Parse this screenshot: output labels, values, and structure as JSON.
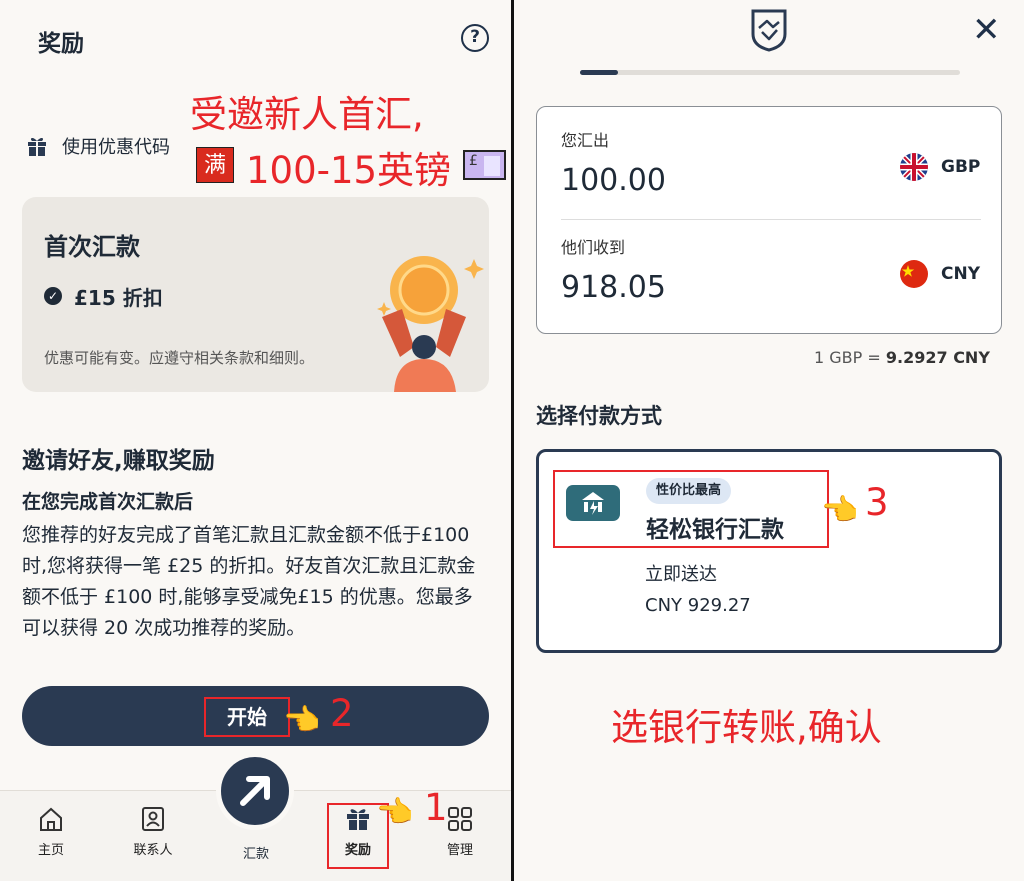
{
  "left": {
    "title": "奖励",
    "help": "?",
    "annotation_line1": "受邀新人首汇,",
    "promo_label": "使用优惠代码",
    "man_badge": "满",
    "annotation_line2": "100-15英镑",
    "banknote": "£",
    "card": {
      "title": "首次汇款",
      "discount": "£15 折扣",
      "note": "优惠可能有变。应遵守相关条款和细则。"
    },
    "invite": {
      "title": "邀请好友,赚取奖励",
      "subtitle": "在您完成首次汇款后",
      "body": "您推荐的好友完成了首笔汇款且汇款金额不低于£100 时,您将获得一笔 £25 的折扣。好友首次汇款且汇款金额不低于 £100 时,能够享受减免£15 的优惠。您最多可以获得 20 次成功推荐的奖励。"
    },
    "start_button": "开始",
    "step_2": "2",
    "step_1": "1",
    "tabs": [
      "主页",
      "联系人",
      "汇款",
      "奖励",
      "管理"
    ]
  },
  "right": {
    "you_send_label": "您汇出",
    "you_send_value": "100.00",
    "send_currency": "GBP",
    "they_receive_label": "他们收到",
    "they_receive_value": "918.05",
    "receive_currency": "CNY",
    "rate_prefix": "1 GBP = ",
    "rate_value": "9.2927 CNY",
    "section_title": "选择付款方式",
    "payment": {
      "tag": "性价比最高",
      "name": "轻松银行汇款",
      "speed": "立即送达",
      "amount": "CNY 929.27"
    },
    "step_3": "3",
    "annotation": "选银行转账,确认"
  },
  "colors": {
    "navy": "#2a3a52",
    "annotation_red": "#e8262a",
    "card_bg": "#ebe8e3"
  },
  "icons": [
    "help-icon",
    "gift-icon",
    "check-icon",
    "home-icon",
    "contacts-icon",
    "send-arrow-icon",
    "gift-tab-icon",
    "grid-icon",
    "logo-icon",
    "close-icon",
    "bank-icon",
    "pointing-hand-icon"
  ],
  "progress_fraction": 0.1
}
